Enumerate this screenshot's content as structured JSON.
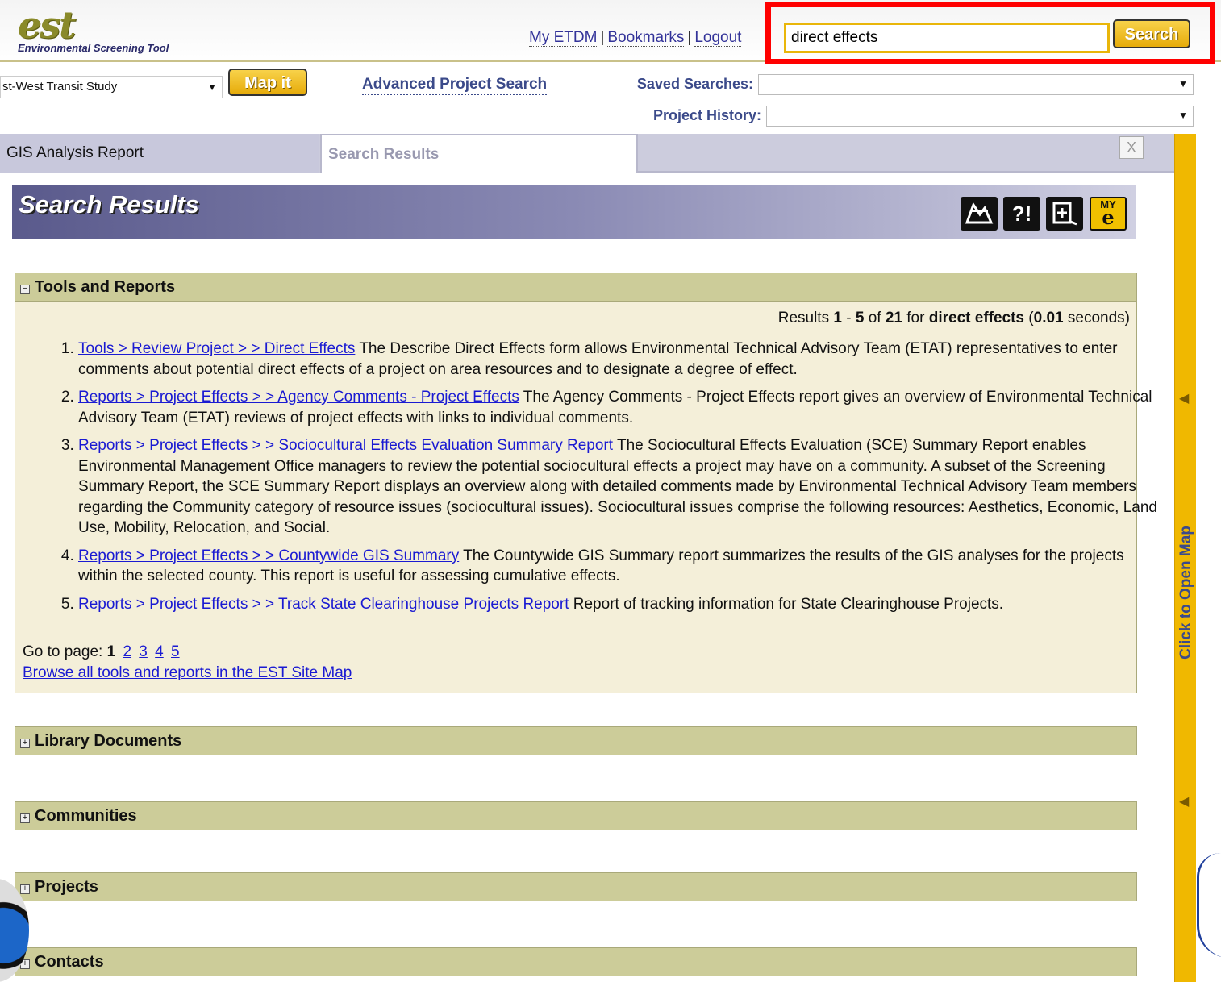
{
  "header": {
    "logo_text": "est",
    "logo_subtitle": "Environmental Screening Tool",
    "links": [
      "My ETDM",
      "Bookmarks",
      "Logout"
    ],
    "search_value": "direct effects",
    "search_button": "Search"
  },
  "toolbar": {
    "project_select_value": "st-West Transit Study",
    "map_it_button": "Map it",
    "advanced_search_link": "Advanced Project Search",
    "saved_searches_label": "Saved Searches:",
    "saved_searches_value": "",
    "project_history_label": "Project History:",
    "project_history_value": ""
  },
  "tabs": {
    "items": [
      "GIS Analysis Report",
      "Search Results"
    ],
    "active": "Search Results",
    "close_label": "X"
  },
  "map_bar": {
    "label": "Click to Open Map"
  },
  "banner": {
    "title": "Search Results",
    "icons": [
      "map-icon",
      "help-icon",
      "print-icon",
      "my-etdm-icon"
    ]
  },
  "sections": {
    "tools": {
      "title": "Tools and Reports",
      "expanded": true,
      "summary": {
        "prefix": "Results",
        "start": "1",
        "end": "5",
        "total": "21",
        "query": "direct effects",
        "time": "0.01",
        "of": "of",
        "for": "for",
        "seconds": "seconds)"
      },
      "results": [
        {
          "link": "Tools > Review Project > > Direct Effects",
          "desc": "The Describe Direct Effects form allows Environmental Technical Advisory Team (ETAT) representatives to enter comments about potential direct effects of a project on area resources and to designate a degree of effect."
        },
        {
          "link": "Reports > Project Effects > > Agency Comments - Project Effects",
          "desc": "The Agency Comments - Project Effects report gives an overview of Environmental Technical Advisory Team (ETAT) reviews of project effects with links to individual comments."
        },
        {
          "link": "Reports > Project Effects > > Sociocultural Effects Evaluation Summary Report",
          "desc": "The Sociocultural Effects Evaluation (SCE) Summary Report enables Environmental Management Office managers to review the potential sociocultural effects a project may have on a community. A subset of the Screening Summary Report, the SCE Summary Report displays an overview along with detailed comments made by Environmental Technical Advisory Team members regarding the Community category of resource issues (sociocultural issues). Sociocultural issues comprise the following resources: Aesthetics, Economic, Land Use, Mobility, Relocation, and Social."
        },
        {
          "link": "Reports > Project Effects > > Countywide GIS Summary",
          "desc": "The Countywide GIS Summary report summarizes the results of the GIS analyses for the projects within the selected county. This report is useful for assessing cumulative effects."
        },
        {
          "link": "Reports > Project Effects > > Track State Clearinghouse Projects Report",
          "desc": "Report of tracking information for State Clearinghouse Projects."
        }
      ],
      "pager_label": "Go to page:",
      "current_page": "1",
      "pages": [
        "2",
        "3",
        "4",
        "5"
      ],
      "sitemap_link": "Browse all tools and reports in the EST Site Map"
    },
    "library": {
      "title": "Library Documents",
      "expanded": false
    },
    "communities": {
      "title": "Communities",
      "expanded": false
    },
    "projects": {
      "title": "Projects",
      "expanded": false
    },
    "contacts": {
      "title": "Contacts",
      "expanded": false
    }
  },
  "colors": {
    "accent_gold": "#f0b800",
    "section_header": "#cccc99",
    "section_body": "#f4efd9",
    "highlight": "#ff0000",
    "link": "#1a1ad2"
  }
}
